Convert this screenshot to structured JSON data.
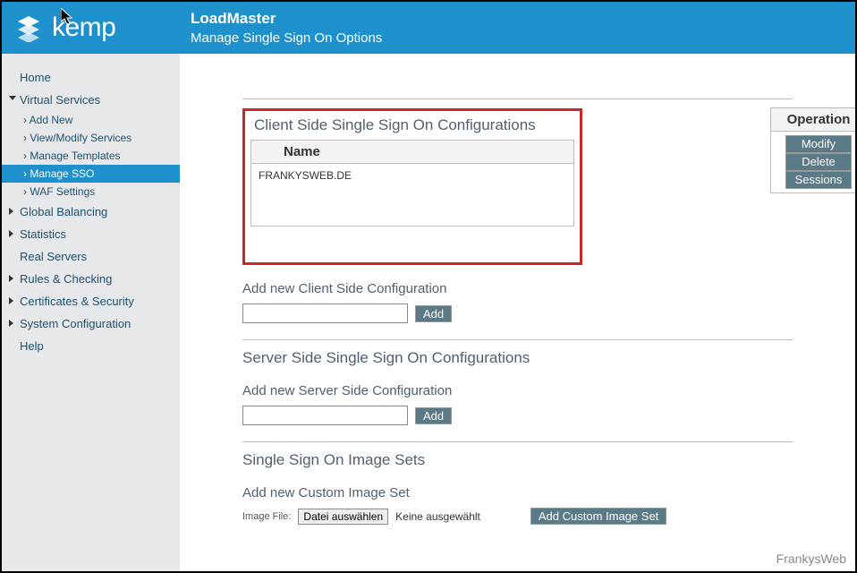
{
  "header": {
    "brand": "kemp",
    "product": "LoadMaster",
    "page_title": "Manage Single Sign On Options"
  },
  "sidebar": {
    "home": "Home",
    "virtual_services": "Virtual Services",
    "vs_children": {
      "add_new": "Add New",
      "view_modify": "View/Modify Services",
      "manage_templates": "Manage Templates",
      "manage_sso": "Manage SSO",
      "waf_settings": "WAF Settings"
    },
    "global_balancing": "Global Balancing",
    "statistics": "Statistics",
    "real_servers": "Real Servers",
    "rules_checking": "Rules & Checking",
    "certs_security": "Certificates & Security",
    "sys_config": "System Configuration",
    "help": "Help"
  },
  "client_sso": {
    "title": "Client Side Single Sign On Configurations",
    "name_header": "Name",
    "op_header": "Operation",
    "row_name": "FRANKYSWEB.DE",
    "ops": {
      "modify": "Modify",
      "delete": "Delete",
      "sessions": "Sessions"
    },
    "add_title": "Add new Client Side Configuration",
    "add_btn": "Add"
  },
  "server_sso": {
    "title": "Server Side Single Sign On Configurations",
    "add_title": "Add new Server Side Configuration",
    "add_btn": "Add"
  },
  "image_sets": {
    "title": "Single Sign On Image Sets",
    "add_title": "Add new Custom Image Set",
    "file_label": "Image File:",
    "choose_btn": "Datei auswählen",
    "no_file": "Keine ausgewählt",
    "add_custom_btn": "Add Custom Image Set"
  },
  "watermark": "FrankysWeb"
}
